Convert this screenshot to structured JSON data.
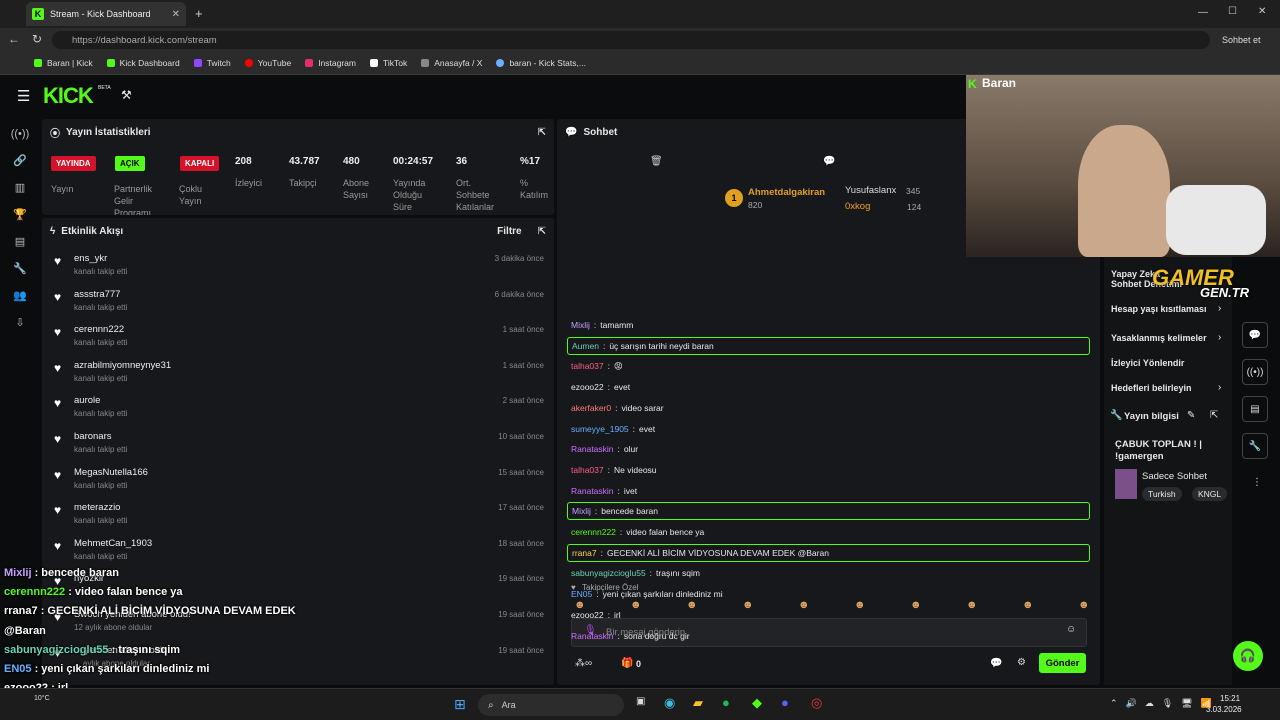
{
  "browser": {
    "tab_title": "Stream - Kick Dashboard",
    "url": "https://dashboard.kick.com/stream",
    "sidebar_right": "Sohbet et",
    "bookmarks": [
      "Baran | Kick",
      "Kick Dashboard",
      "Twitch",
      "YouTube",
      "Instagram",
      "TikTok",
      "Anasayfa / X",
      "baran - Kick Stats,..."
    ]
  },
  "colors": {
    "accent": "#53fc18",
    "live_red": "#d4122a"
  },
  "header": {
    "logo": "KICK",
    "logo_sup": "BETA"
  },
  "stats": {
    "title": "Yayın İstatistikleri",
    "b1": "YAYINDA",
    "b2": "AÇIK",
    "b3": "KAPALI",
    "l1": "Yayın",
    "l2": "Partnerlik Gelir Programı",
    "l3": "Çoklu Yayın",
    "viewers": "208",
    "viewers_l": "İzleyici",
    "followers": "43.787",
    "followers_l": "Takipçi",
    "subs": "480",
    "subs_l": "Abone Sayısı",
    "uptime": "00:24:57",
    "uptime_l": "Yayında Olduğu Süre",
    "avg": "36",
    "avg_l": "Ort. Sohbete Katılanlar",
    "pct": "%17",
    "pct_l": "% Katılım"
  },
  "activity": {
    "title": "Etkinlik Akışı",
    "filter": "Filtre",
    "items": [
      {
        "user": "ens_ykr",
        "sub": "kanalı takip etti",
        "time": "3 dakika önce"
      },
      {
        "user": "assstra777",
        "sub": "kanalı takip etti",
        "time": "6 dakika önce"
      },
      {
        "user": "cerennn222",
        "sub": "kanalı takip etti",
        "time": "1 saat önce"
      },
      {
        "user": "azrabilmiyomneynye31",
        "sub": "kanalı takip etti",
        "time": "1 saat önce"
      },
      {
        "user": "aurole",
        "sub": "kanalı takip etti",
        "time": "2 saat önce"
      },
      {
        "user": "baronars",
        "sub": "kanalı takip etti",
        "time": "10 saat önce"
      },
      {
        "user": "MegasNutella166",
        "sub": "kanalı takip etti",
        "time": "15 saat önce"
      },
      {
        "user": "meterazzio",
        "sub": "kanalı takip etti",
        "time": "17 saat önce"
      },
      {
        "user": "MehmetCan_1903",
        "sub": "kanalı takip etti",
        "time": "18 saat önce"
      },
      {
        "user": "hyozkir",
        "sub": "",
        "time": "19 saat önce"
      },
      {
        "user": "Swoch yeniden abone oldu!",
        "sub": "12 aylık abone oldular",
        "time": "19 saat önce"
      },
      {
        "user": "... yeniden abone oldu!",
        "sub": "... aylık abone oldular",
        "time": "19 saat önce"
      }
    ]
  },
  "chat": {
    "title": "Sohbet",
    "leader1": "Ahmetdalgakiran",
    "leader1_n": "820",
    "leader2": "Yusufaslanx",
    "leader2_n": "345",
    "leader3": "0xkog",
    "leader3_n": "124",
    "follower_label": "Takipçilere Özel",
    "placeholder": "Bir mesaj gönderin",
    "count": "0",
    "send": "Gönder",
    "messages": [
      {
        "u": "Mixlij",
        "c": "#c8a0ff",
        "t": "tamamm",
        "hl": false
      },
      {
        "u": "Aumen",
        "c": "#6ad3b3",
        "t": "üç sarışın tarihi neydi baran",
        "hl": true
      },
      {
        "u": "talha037",
        "c": "#ff5c8a",
        "t": "😡",
        "hl": false
      },
      {
        "u": "ezooo22",
        "c": "#e8e8e8",
        "t": "evet",
        "hl": false
      },
      {
        "u": "akerfaker0",
        "c": "#ff7a7a",
        "t": "video sarar",
        "hl": false
      },
      {
        "u": "sumeyye_1905",
        "c": "#6ab0ff",
        "t": "evet",
        "hl": false
      },
      {
        "u": "Ranataskin",
        "c": "#d070ff",
        "t": "olur",
        "hl": false
      },
      {
        "u": "talha037",
        "c": "#ff5c8a",
        "t": "Ne videosu",
        "hl": false
      },
      {
        "u": "Ranataskin",
        "c": "#d070ff",
        "t": "ivet",
        "hl": false
      },
      {
        "u": "Mixlij",
        "c": "#c8a0ff",
        "t": "bencede baran",
        "hl": true
      },
      {
        "u": "cerennn222",
        "c": "#53fc18",
        "t": "video falan bence ya",
        "hl": false
      },
      {
        "u": "rrana7",
        "c": "#ffd84a",
        "t": "GECENKİ ALİ BİCİM VİDYOSUNA DEVAM EDEK @Baran",
        "hl": true
      },
      {
        "u": "sabunyagizcioglu55",
        "c": "#6ad3b3",
        "t": "traşını sqim",
        "hl": false
      },
      {
        "u": "EN05",
        "c": "#6ab0ff",
        "t": "yeni çıkan şarkıları dinlediniz mi",
        "hl": false
      },
      {
        "u": "ezooo22",
        "c": "#e8e8e8",
        "t": "irl",
        "hl": false
      },
      {
        "u": "Ranataskin",
        "c": "#d070ff",
        "t": "sona doğru dc gir",
        "hl": false
      }
    ]
  },
  "right": {
    "webcam_name": "Baran",
    "menu": [
      "Yapay Zeka Sohbet Denetimi",
      "Hesap yaşı kısıtlaması",
      "Yasaklanmış kelimeler",
      "İzleyici Yönlendir",
      "Hedefleri belirleyin"
    ],
    "info_title": "Yayın bilgisi",
    "stream_title": "ÇABUK TOPLAN ! | !gamergen",
    "category": "Sadece Sohbet",
    "tag1": "Turkish",
    "tag2": "KNGL",
    "gamer": "GAMER",
    "gen": "GEN.TR"
  },
  "overlay": [
    {
      "u": "Mixlij",
      "t": " : bencede baran",
      "c": "#c8a0ff"
    },
    {
      "u": "cerennn222",
      "t": " : video falan bence ya",
      "c": "#53fc18"
    },
    {
      "u": "rrana7",
      "t": " : GECENKİ ALİ BİCİM VİDYOSUNA DEVAM EDEK",
      "c": "#fff"
    },
    {
      "u": "@Baran",
      "t": "",
      "c": "#fff"
    },
    {
      "u": "sabunyagizcioglu55",
      "t": " : traşını sqim",
      "c": "#6ad3b3"
    },
    {
      "u": "EN05",
      "t": " : yeni çıkan şarkıları dinlediniz mi",
      "c": "#6ab0ff"
    },
    {
      "u": "ezooo22",
      "t": " : irl",
      "c": "#fff"
    },
    {
      "u": "Ranataskin",
      "t": " : sona doğru dc gir",
      "c": "#d070ff"
    }
  ],
  "taskbar": {
    "search": "Ara",
    "time": "15:21",
    "date": "3.03.2026",
    "weather": "10°C"
  }
}
